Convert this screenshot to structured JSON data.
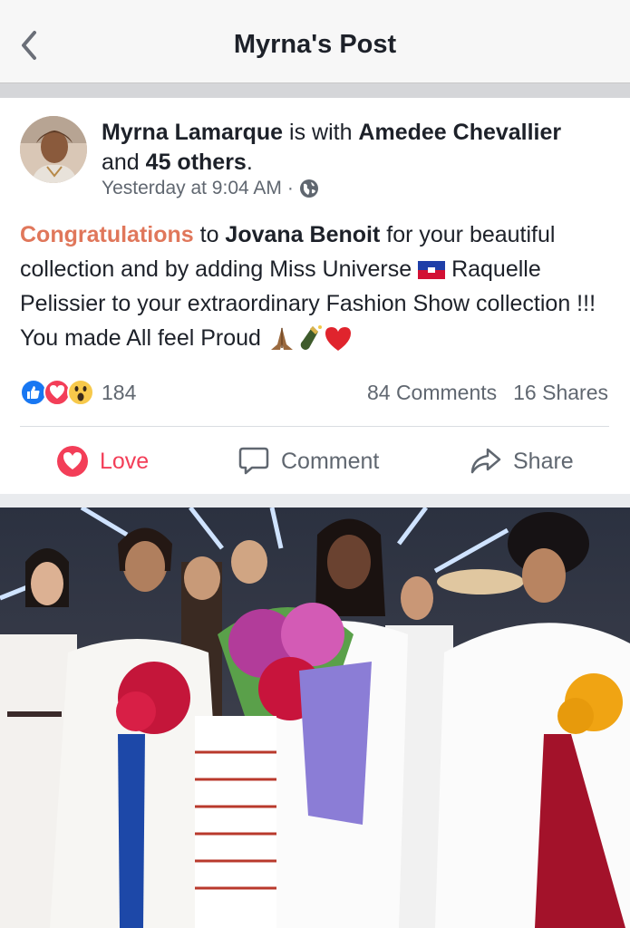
{
  "nav": {
    "title": "Myrna's Post"
  },
  "post": {
    "author": "Myrna Lamarque",
    "with_text": " is with ",
    "tagged": "Amedee Chevallier",
    "and_text": "and ",
    "others": "45 others",
    "period": ".",
    "time": "Yesterday at 9:04 AM",
    "dot": "·",
    "body": {
      "hl": "Congratulations",
      "to": " to ",
      "name": "Jovana Benoit",
      "rest1": " for your beautiful collection and by adding Miss Universe ",
      "rest2": " Raquelle Pelissier to your extraordinary Fashion Show collection !!! You made All feel Proud "
    }
  },
  "reactions": {
    "count": "184",
    "comments": "84 Comments",
    "shares": "16 Shares"
  },
  "actions": {
    "love": "Love",
    "comment": "Comment",
    "share": "Share"
  },
  "colors": {
    "love": "#f33e58",
    "highlight": "#e0775b",
    "like": "#1877f2"
  }
}
